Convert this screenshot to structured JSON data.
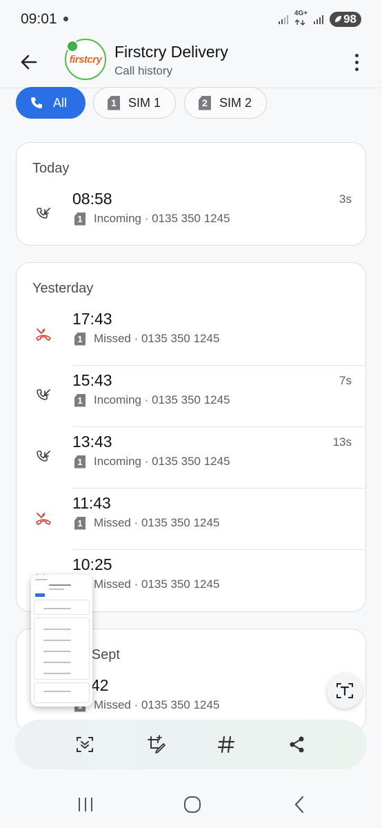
{
  "status_bar": {
    "time": "09:01",
    "network": "4G+",
    "battery": "98"
  },
  "header": {
    "avatar_logo": "firstcry",
    "contact_name": "Firstcry Delivery",
    "subtitle": "Call history"
  },
  "filters": [
    {
      "label": "All",
      "selected": true
    },
    {
      "label": "SIM 1",
      "sim": "1",
      "selected": false
    },
    {
      "label": "SIM 2",
      "sim": "2",
      "selected": false
    }
  ],
  "colors": {
    "accent": "#2a6fe3",
    "missed": "#d93a2e",
    "incoming": "#444444"
  },
  "groups": [
    {
      "title": "Today",
      "calls": [
        {
          "time": "08:58",
          "sim": "1",
          "type": "incoming",
          "meta": "Incoming · 0135 350 1245",
          "duration": "3s"
        }
      ]
    },
    {
      "title": "Yesterday",
      "calls": [
        {
          "time": "17:43",
          "sim": "1",
          "type": "missed",
          "meta": "Missed · 0135 350 1245",
          "duration": ""
        },
        {
          "time": "15:43",
          "sim": "1",
          "type": "incoming",
          "meta": "Incoming · 0135 350 1245",
          "duration": "7s"
        },
        {
          "time": "13:43",
          "sim": "1",
          "type": "incoming",
          "meta": "Incoming · 0135 350 1245",
          "duration": "13s"
        },
        {
          "time": "11:43",
          "sim": "1",
          "type": "missed",
          "meta": "Missed · 0135 350 1245",
          "duration": ""
        },
        {
          "time": "10:25",
          "sim": "1",
          "type": "missed",
          "meta": "Missed · 0135 350 1245",
          "duration": ""
        }
      ]
    },
    {
      "title": "02 Sept",
      "calls": [
        {
          "time": "42",
          "sim": "1",
          "type": "missed",
          "meta": "Missed · 0135 350 1245",
          "duration": ""
        }
      ]
    }
  ],
  "toolbar": {
    "items": [
      "scroll-capture-icon",
      "crop-edit-icon",
      "hashtag-icon",
      "share-icon"
    ]
  },
  "navigation": [
    "recent-apps-icon",
    "home-icon",
    "back-icon"
  ]
}
